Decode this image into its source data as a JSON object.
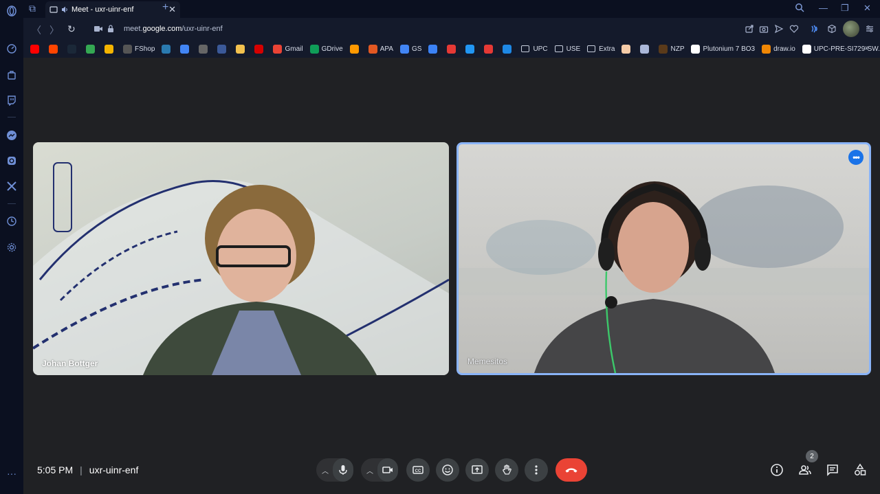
{
  "browser": {
    "tab": {
      "title": "Meet - uxr-uinr-enf"
    },
    "address": {
      "url_prefix": "meet.",
      "url_domain": "google.com",
      "url_path": "/uxr-uinr-enf"
    }
  },
  "bookmarks": [
    {
      "label": "",
      "color": "#ff0000",
      "icon": "youtube-icon"
    },
    {
      "label": "",
      "color": "#ff4500",
      "icon": "reddit-icon"
    },
    {
      "label": "",
      "color": "#1b2838",
      "icon": "steam-icon"
    },
    {
      "label": "",
      "color": "#34a853",
      "icon": "chrome-icon"
    },
    {
      "label": "",
      "color": "#f4b400",
      "icon": "emoji-icon"
    },
    {
      "label": "FShop",
      "color": "#555555",
      "icon": "fshop-icon"
    },
    {
      "label": "",
      "color": "#2a7ab0",
      "icon": "tl-icon"
    },
    {
      "label": "",
      "color": "#4285f4",
      "icon": "jira-icon"
    },
    {
      "label": "",
      "color": "#666666",
      "icon": "item-icon"
    },
    {
      "label": "",
      "color": "#3b5998",
      "icon": "roblox-icon"
    },
    {
      "label": "",
      "color": "#f2c14e",
      "icon": "feather-icon"
    },
    {
      "label": "",
      "color": "#d50000",
      "icon": "v-icon"
    },
    {
      "label": "Gmail",
      "color": "#ea4335",
      "icon": "gmail-icon"
    },
    {
      "label": "GDrive",
      "color": "#0f9d58",
      "icon": "gdrive-icon"
    },
    {
      "label": "",
      "color": "#ff9900",
      "icon": "amazon-icon"
    },
    {
      "label": "APA",
      "color": "#e25822",
      "icon": "apa-icon"
    },
    {
      "label": "GS",
      "color": "#4285f4",
      "icon": "scholar-icon"
    },
    {
      "label": "",
      "color": "#3b82f6",
      "icon": "arrow-icon"
    },
    {
      "label": "",
      "color": "#e53935",
      "icon": "sy-icon"
    },
    {
      "label": "",
      "color": "#2196f3",
      "icon": "crossed-icon"
    },
    {
      "label": "",
      "color": "#e53935",
      "icon": "heart-icon"
    },
    {
      "label": "",
      "color": "#1e88e5",
      "icon": "diamond-icon"
    },
    {
      "label": "UPC",
      "color": "",
      "icon": "folder-icon"
    },
    {
      "label": "USE",
      "color": "",
      "icon": "folder-icon"
    },
    {
      "label": "Extra",
      "color": "",
      "icon": "folder-icon"
    },
    {
      "label": "",
      "color": "#f5cba7",
      "icon": "face-icon"
    },
    {
      "label": "",
      "color": "#aab7d8",
      "icon": "lines-icon"
    },
    {
      "label": "NZP",
      "color": "#5a3a1a",
      "icon": "nzp-icon"
    },
    {
      "label": "Plutonium 7 BO3",
      "color": "#ffffff",
      "icon": "github-icon"
    },
    {
      "label": "draw.io",
      "color": "#f08705",
      "icon": "drawio-icon"
    },
    {
      "label": "UPC-PRE-SI729-SW...",
      "color": "#ffffff",
      "icon": "github-icon"
    }
  ],
  "participants": [
    {
      "name": "Johan Bottger"
    },
    {
      "name": "Memesitos"
    }
  ],
  "meeting": {
    "time": "5:05 PM",
    "code": "uxr-uinr-enf",
    "people_count": "2"
  },
  "colors": {
    "hangup": "#ea4335",
    "accent": "#8ab4f8",
    "more_button": "#1a73e8"
  }
}
